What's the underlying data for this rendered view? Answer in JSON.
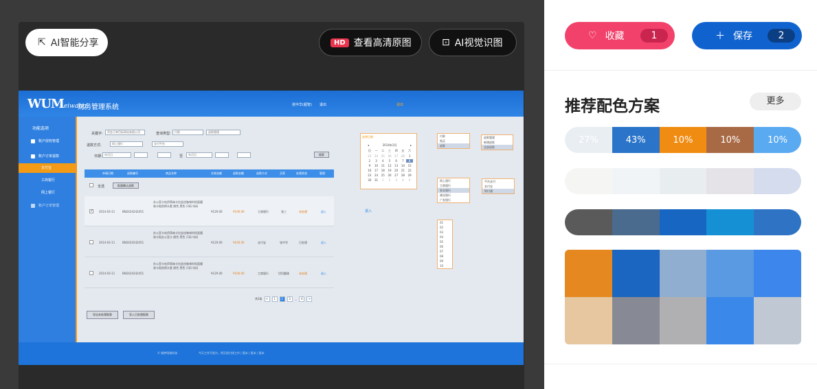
{
  "viewer": {
    "share_label": "AI智能分享",
    "hd_badge": "HD",
    "hd_label": "查看高清原图",
    "ai_label": "AI视觉识图"
  },
  "app": {
    "logo_text": "WUM",
    "logo_sub": "eiwang",
    "system_title": "财务管理系统",
    "user_name": "张中华(超管)",
    "logout": "退出",
    "header_right": "退出",
    "sidebar": {
      "title": "功能选项",
      "items": [
        {
          "label": "账户授权管理"
        },
        {
          "label": "账户订单退款"
        },
        {
          "label": "账户订单管理"
        }
      ],
      "subitems": [
        "支付宝",
        "工商银行",
        "网上银行"
      ]
    },
    "filters": {
      "keyword_label": "关键字:",
      "keyword_value": "资金订单目标网站有限公司",
      "query_type_label": "查询类型:",
      "query_type_value": "付款",
      "query_type2_value": "退款管理",
      "method_label": "退款方式:",
      "method_value1": "网上银行",
      "method_value2": "支付平台",
      "date_label": "日期:",
      "date_start": "年月日",
      "date_end": "年月日",
      "to_label": "至",
      "search_btn": "搜索"
    },
    "table": {
      "headers": [
        "申请日期",
        "退款编号",
        "商品名称",
        "交易金额",
        "退款金额",
        "退款方式",
        "买家",
        "处理状态",
        "管理"
      ],
      "select_all": "全选",
      "batch_btn": "批量确认退款",
      "rows": [
        {
          "date": "2014-03-11",
          "no": "BN2424242451",
          "name": "办公室卡哇伊萌味卡拉益也咖啡时尚面膜收卡贴防摔头套 颜色 黑色 尺码 均码",
          "amount": "¥129.00",
          "refund": "¥100.00",
          "method": "工商银行",
          "buyer": "张三",
          "status": "未处理",
          "action": "退入",
          "checked": true
        },
        {
          "date": "2014-03-11",
          "no": "BN2424242451",
          "name": "办公室卡哇伊萌味卡拉益也咖啡时尚面膜收卡贴办公室卡 颜色 黑色 尺码 均码",
          "amount": "¥129.00",
          "refund": "¥100.00",
          "method": "支付宝",
          "buyer": "张中华",
          "status": "已处理",
          "action": "退入",
          "checked": false
        },
        {
          "date": "2014-03-11",
          "no": "BN2424242451",
          "name": "办公室卡哇伊萌味卡拉益也咖啡时尚面膜收卡贴防摔头套 颜色 黑色 尺码 均码",
          "amount": "¥129.00",
          "refund": "¥100.00",
          "method": "工商银行",
          "buyer": "切切圆珠",
          "status": "未处理",
          "action": "退入",
          "checked": false
        }
      ],
      "side_link": "退入"
    },
    "pager": {
      "total": "共2条",
      "pages": [
        "<",
        "1",
        "2",
        "3",
        "...",
        "4",
        ">"
      ]
    },
    "export1": "导出未处理报表",
    "export2": "导入已处理报表",
    "footer_left": "© 微梦网络科技",
    "footer_mid": "今天工作不努力，明天努力找工作 | 版本 | 版本 | 版本",
    "calendar": {
      "title": "选择日期",
      "month": "2014年3月",
      "weekdays": [
        "日",
        "一",
        "二",
        "三",
        "四",
        "五",
        "六"
      ],
      "days": [
        "23",
        "24",
        "25",
        "26",
        "27",
        "28",
        "1",
        "2",
        "3",
        "4",
        "5",
        "6",
        "7",
        "8",
        "9",
        "10",
        "11",
        "12",
        "13",
        "14",
        "15",
        "16",
        "17",
        "18",
        "19",
        "20",
        "21",
        "22",
        "23",
        "24",
        "25",
        "26",
        "27",
        "28",
        "29",
        "30",
        "31",
        "1",
        "2",
        "3",
        "4",
        "5"
      ]
    },
    "dropdowns": {
      "d1": [
        "付款",
        "购买",
        "退款"
      ],
      "d2": [
        "退款管理",
        "新增退款",
        "全部退款"
      ],
      "d3": [
        "网上银行",
        "工商银行",
        "农业银行",
        "建设银行",
        "广发银行"
      ],
      "d4": [
        "平台支付",
        "支付宝",
        "财付通"
      ],
      "d5": [
        "01",
        "02",
        "03",
        "04",
        "05",
        "06",
        "07",
        "08",
        "09",
        "10"
      ]
    }
  },
  "panel": {
    "fav_label": "收藏",
    "fav_count": "1",
    "save_label": "保存",
    "save_count": "2",
    "title": "推荐配色方案",
    "more": "更多",
    "bar1": [
      {
        "color": "#e9eef3",
        "pct": "27%"
      },
      {
        "color": "#2a74c9",
        "pct": "43%"
      },
      {
        "color": "#f08c12",
        "pct": "10%"
      },
      {
        "color": "#a86a45",
        "pct": "10%"
      },
      {
        "color": "#5aaaf2",
        "pct": "10%"
      }
    ],
    "bar2": [
      "#f5f5f3",
      "#f1f4f6",
      "#e8edef",
      "#e6e3e8",
      "#d4dced"
    ],
    "bar3": [
      "#5a5a5a",
      "#4a6b8e",
      "#1767c2",
      "#1690d4",
      "#2e73c4"
    ],
    "grid": [
      "#e5881f",
      "#1a66c0",
      "#90aed0",
      "#5a9ae2",
      "#3d87ec",
      "#e6c7a0",
      "#878a95",
      "#b0b0b3",
      "#3a88ea",
      "#bfc8d3"
    ]
  }
}
